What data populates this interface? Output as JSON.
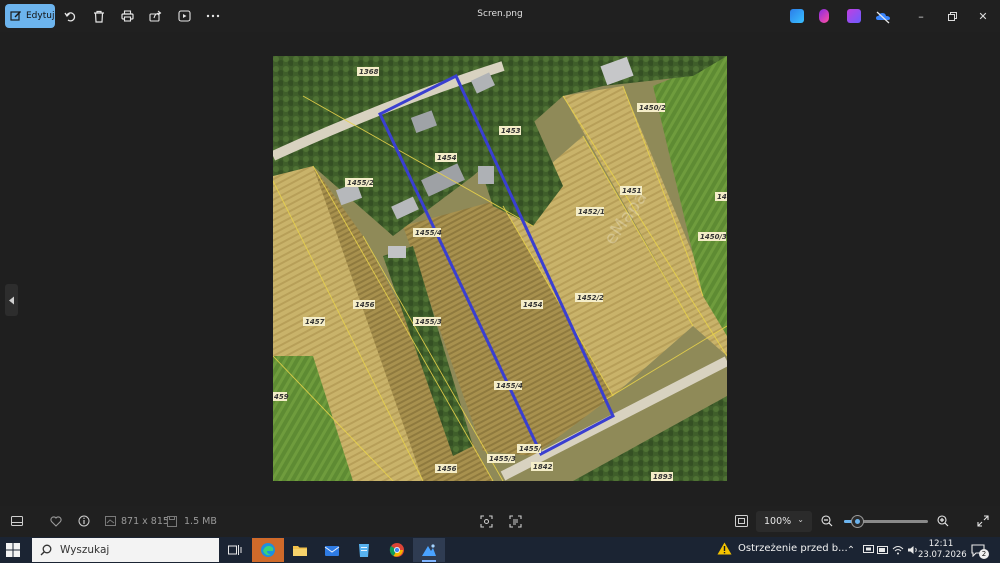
{
  "app": {
    "edit_label": "Edytuj",
    "file_title": "Scren.png"
  },
  "toolbar": {
    "icons": [
      "edit-icon",
      "rotate-icon",
      "delete-icon",
      "print-icon",
      "share-icon",
      "slideshow-icon",
      "more-icon"
    ],
    "apps": [
      "photos-editor-icon",
      "clipchamp-icon",
      "copilot-app-icon",
      "onedrive-icon"
    ],
    "window_controls": [
      "minimize-icon",
      "restore-icon",
      "close-icon"
    ]
  },
  "map": {
    "parcels": {
      "p1368": "1368",
      "p1450_2": "1450/2",
      "p1453": "1453",
      "p1454_top": "1454",
      "p1455_2": "1455/2",
      "p1451": "1451",
      "p14_edge": "14",
      "p1452_1": "1452/1",
      "p1450_3": "1450/3",
      "p1455_4": "1455/4",
      "p1456_mid": "1456",
      "p1457": "1457",
      "p1454_mid": "1454",
      "p1452_2": "1452/2",
      "p1455_3_mid": "1455/3",
      "p1455_x4": "1455/4",
      "p459": "459",
      "p1455_low": "1455/",
      "p1455_3_low": "1455/3",
      "p1842": "1842",
      "p1456_low": "1456",
      "p1893": "1893"
    }
  },
  "status": {
    "dimensions": "871 x 815",
    "filesize": "1.5 MB",
    "zoom_label": "100%",
    "zoom_level": 0.15
  },
  "taskbar": {
    "search_label": "Wyszukaj",
    "warning_text": "Ostrzeżenie przed b...",
    "time": "12:11",
    "date": "23.07.2026",
    "notification_count": "2",
    "colors": {
      "accent": "#6cb4ee",
      "taskbar_bg": "#1b2433"
    }
  }
}
